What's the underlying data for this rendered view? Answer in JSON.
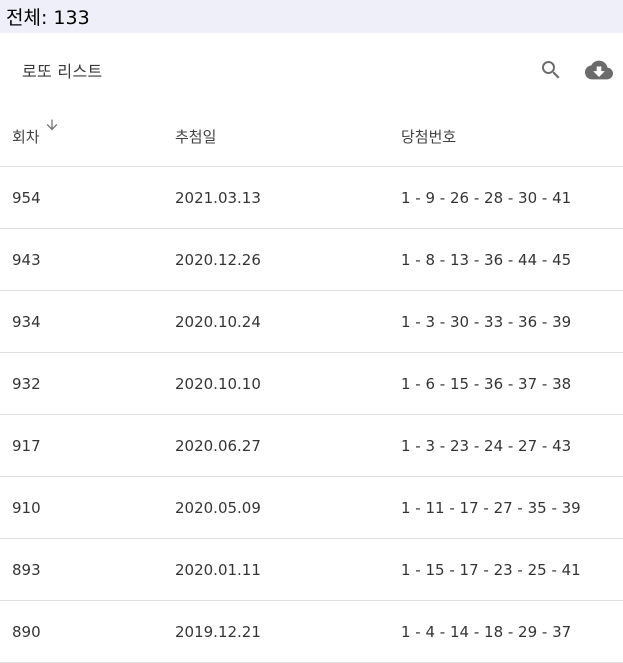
{
  "total": {
    "label": "전체: 133"
  },
  "toolbar": {
    "title": "로또 리스트",
    "search_icon": "search-icon",
    "download_icon": "cloud-download-icon",
    "icon_color": "#6b6b6b"
  },
  "table": {
    "columns": [
      {
        "label": "회차",
        "sort": "descending"
      },
      {
        "label": "추첨일"
      },
      {
        "label": "당첨번호"
      }
    ],
    "rows": [
      {
        "round": "954",
        "date": "2021.03.13",
        "numbers": "1 - 9 - 26 - 28 - 30 - 41"
      },
      {
        "round": "943",
        "date": "2020.12.26",
        "numbers": "1 - 8 - 13 - 36 - 44 - 45"
      },
      {
        "round": "934",
        "date": "2020.10.24",
        "numbers": "1 - 3 - 30 - 33 - 36 - 39"
      },
      {
        "round": "932",
        "date": "2020.10.10",
        "numbers": "1 - 6 - 15 - 36 - 37 - 38"
      },
      {
        "round": "917",
        "date": "2020.06.27",
        "numbers": "1 - 3 - 23 - 24 - 27 - 43"
      },
      {
        "round": "910",
        "date": "2020.05.09",
        "numbers": "1 - 11 - 17 - 27 - 35 - 39"
      },
      {
        "round": "893",
        "date": "2020.01.11",
        "numbers": "1 - 15 - 17 - 23 - 25 - 41"
      },
      {
        "round": "890",
        "date": "2019.12.21",
        "numbers": "1 - 4 - 14 - 18 - 29 - 37"
      }
    ]
  },
  "colors": {
    "total_bar_bg": "#efeff9",
    "divider": "#e0e0e0"
  }
}
